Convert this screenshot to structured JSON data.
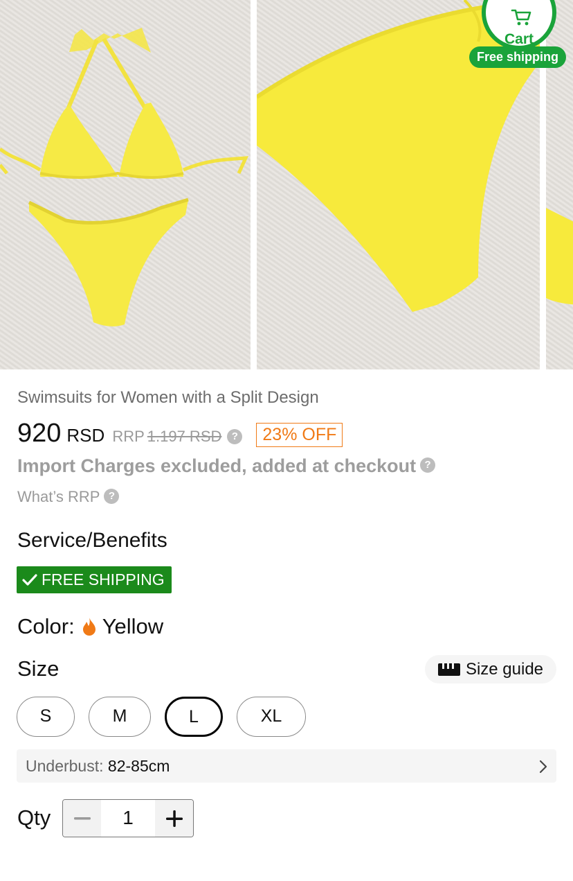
{
  "cart": {
    "label": "Cart",
    "shipping_pill": "Free shipping"
  },
  "product": {
    "title": "Swimsuits for Women with a Split Design",
    "price": "920",
    "currency": "RSD",
    "rrp_label": "RRP",
    "rrp_value": "1.197 RSD",
    "discount": "23% OFF",
    "import_note": "Import Charges excluded, added at checkout",
    "whats_rrp": "What’s RRP"
  },
  "benefits": {
    "heading": "Service/Benefits",
    "badge": "FREE SHIPPING"
  },
  "color": {
    "label": "Color:",
    "value": "Yellow",
    "swatch": "#f07a16"
  },
  "size": {
    "label": "Size",
    "guide_label": "Size guide",
    "options": [
      "S",
      "M",
      "L",
      "XL"
    ],
    "selected": "L"
  },
  "underbust": {
    "label": "Underbust:",
    "value": "82-85cm"
  },
  "qty": {
    "label": "Qty",
    "value": "1"
  },
  "colors": {
    "accent_green": "#1aa33a",
    "badge_green": "#1b8a1b",
    "discount_orange": "#f07a16",
    "product_yellow": "#f7ea3c"
  }
}
